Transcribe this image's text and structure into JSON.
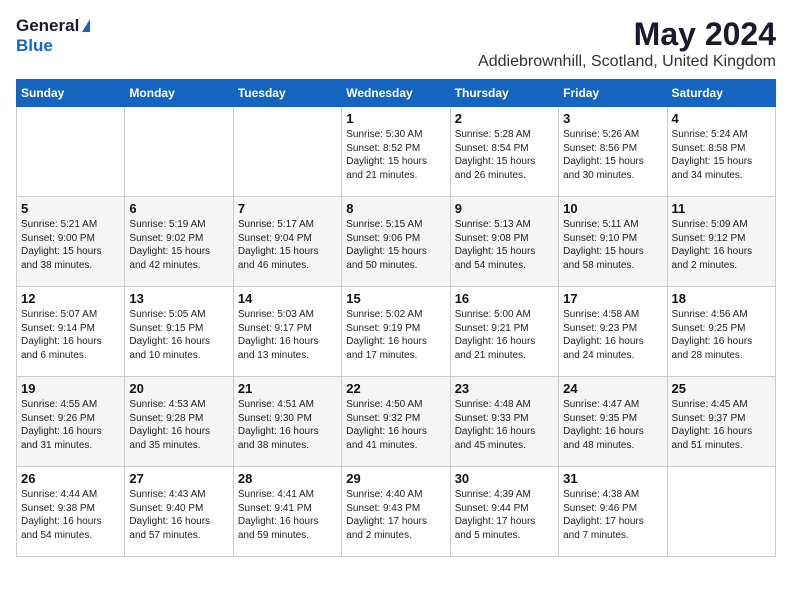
{
  "logo": {
    "general": "General",
    "blue": "Blue"
  },
  "title": "May 2024",
  "subtitle": "Addiebrownhill, Scotland, United Kingdom",
  "headers": [
    "Sunday",
    "Monday",
    "Tuesday",
    "Wednesday",
    "Thursday",
    "Friday",
    "Saturday"
  ],
  "weeks": [
    [
      {
        "day": "",
        "info": ""
      },
      {
        "day": "",
        "info": ""
      },
      {
        "day": "",
        "info": ""
      },
      {
        "day": "1",
        "info": "Sunrise: 5:30 AM\nSunset: 8:52 PM\nDaylight: 15 hours\nand 21 minutes."
      },
      {
        "day": "2",
        "info": "Sunrise: 5:28 AM\nSunset: 8:54 PM\nDaylight: 15 hours\nand 26 minutes."
      },
      {
        "day": "3",
        "info": "Sunrise: 5:26 AM\nSunset: 8:56 PM\nDaylight: 15 hours\nand 30 minutes."
      },
      {
        "day": "4",
        "info": "Sunrise: 5:24 AM\nSunset: 8:58 PM\nDaylight: 15 hours\nand 34 minutes."
      }
    ],
    [
      {
        "day": "5",
        "info": "Sunrise: 5:21 AM\nSunset: 9:00 PM\nDaylight: 15 hours\nand 38 minutes."
      },
      {
        "day": "6",
        "info": "Sunrise: 5:19 AM\nSunset: 9:02 PM\nDaylight: 15 hours\nand 42 minutes."
      },
      {
        "day": "7",
        "info": "Sunrise: 5:17 AM\nSunset: 9:04 PM\nDaylight: 15 hours\nand 46 minutes."
      },
      {
        "day": "8",
        "info": "Sunrise: 5:15 AM\nSunset: 9:06 PM\nDaylight: 15 hours\nand 50 minutes."
      },
      {
        "day": "9",
        "info": "Sunrise: 5:13 AM\nSunset: 9:08 PM\nDaylight: 15 hours\nand 54 minutes."
      },
      {
        "day": "10",
        "info": "Sunrise: 5:11 AM\nSunset: 9:10 PM\nDaylight: 15 hours\nand 58 minutes."
      },
      {
        "day": "11",
        "info": "Sunrise: 5:09 AM\nSunset: 9:12 PM\nDaylight: 16 hours\nand 2 minutes."
      }
    ],
    [
      {
        "day": "12",
        "info": "Sunrise: 5:07 AM\nSunset: 9:14 PM\nDaylight: 16 hours\nand 6 minutes."
      },
      {
        "day": "13",
        "info": "Sunrise: 5:05 AM\nSunset: 9:15 PM\nDaylight: 16 hours\nand 10 minutes."
      },
      {
        "day": "14",
        "info": "Sunrise: 5:03 AM\nSunset: 9:17 PM\nDaylight: 16 hours\nand 13 minutes."
      },
      {
        "day": "15",
        "info": "Sunrise: 5:02 AM\nSunset: 9:19 PM\nDaylight: 16 hours\nand 17 minutes."
      },
      {
        "day": "16",
        "info": "Sunrise: 5:00 AM\nSunset: 9:21 PM\nDaylight: 16 hours\nand 21 minutes."
      },
      {
        "day": "17",
        "info": "Sunrise: 4:58 AM\nSunset: 9:23 PM\nDaylight: 16 hours\nand 24 minutes."
      },
      {
        "day": "18",
        "info": "Sunrise: 4:56 AM\nSunset: 9:25 PM\nDaylight: 16 hours\nand 28 minutes."
      }
    ],
    [
      {
        "day": "19",
        "info": "Sunrise: 4:55 AM\nSunset: 9:26 PM\nDaylight: 16 hours\nand 31 minutes."
      },
      {
        "day": "20",
        "info": "Sunrise: 4:53 AM\nSunset: 9:28 PM\nDaylight: 16 hours\nand 35 minutes."
      },
      {
        "day": "21",
        "info": "Sunrise: 4:51 AM\nSunset: 9:30 PM\nDaylight: 16 hours\nand 38 minutes."
      },
      {
        "day": "22",
        "info": "Sunrise: 4:50 AM\nSunset: 9:32 PM\nDaylight: 16 hours\nand 41 minutes."
      },
      {
        "day": "23",
        "info": "Sunrise: 4:48 AM\nSunset: 9:33 PM\nDaylight: 16 hours\nand 45 minutes."
      },
      {
        "day": "24",
        "info": "Sunrise: 4:47 AM\nSunset: 9:35 PM\nDaylight: 16 hours\nand 48 minutes."
      },
      {
        "day": "25",
        "info": "Sunrise: 4:45 AM\nSunset: 9:37 PM\nDaylight: 16 hours\nand 51 minutes."
      }
    ],
    [
      {
        "day": "26",
        "info": "Sunrise: 4:44 AM\nSunset: 9:38 PM\nDaylight: 16 hours\nand 54 minutes."
      },
      {
        "day": "27",
        "info": "Sunrise: 4:43 AM\nSunset: 9:40 PM\nDaylight: 16 hours\nand 57 minutes."
      },
      {
        "day": "28",
        "info": "Sunrise: 4:41 AM\nSunset: 9:41 PM\nDaylight: 16 hours\nand 59 minutes."
      },
      {
        "day": "29",
        "info": "Sunrise: 4:40 AM\nSunset: 9:43 PM\nDaylight: 17 hours\nand 2 minutes."
      },
      {
        "day": "30",
        "info": "Sunrise: 4:39 AM\nSunset: 9:44 PM\nDaylight: 17 hours\nand 5 minutes."
      },
      {
        "day": "31",
        "info": "Sunrise: 4:38 AM\nSunset: 9:46 PM\nDaylight: 17 hours\nand 7 minutes."
      },
      {
        "day": "",
        "info": ""
      }
    ]
  ]
}
